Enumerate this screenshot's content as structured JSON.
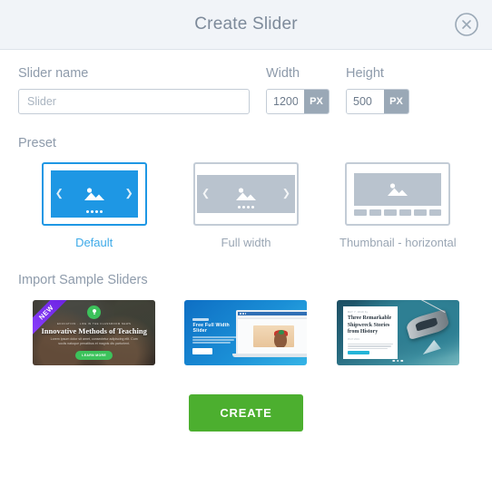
{
  "header": {
    "title": "Create Slider",
    "close_icon": "close-circle-icon"
  },
  "form": {
    "name_label": "Slider name",
    "name_value": "",
    "name_placeholder": "Slider",
    "width_label": "Width",
    "width_value": "1200",
    "width_unit": "PX",
    "height_label": "Height",
    "height_value": "500",
    "height_unit": "PX"
  },
  "preset": {
    "section_label": "Preset",
    "selected": "Default",
    "items": [
      {
        "label": "Default",
        "layout": "boxed",
        "selected": true
      },
      {
        "label": "Full width",
        "layout": "fullwidth",
        "selected": false
      },
      {
        "label": "Thumbnail - horizontal",
        "layout": "thumbnail",
        "selected": false
      }
    ]
  },
  "samples": {
    "section_label": "Import Sample Sliders",
    "items": [
      {
        "badge": "NEW",
        "kicker": "EDUCATION  ·  LIFE IN THE CLASSROOM NEWS",
        "title": "Innovative Methods of Teaching",
        "subtitle": "Lorem ipsum dolor sit amet, consectetur adipiscing elit. Cum sociis natoque penatibus et magnis dis parturient.",
        "button": "LEARN MORE"
      },
      {
        "kicker": "",
        "title": "Free Full Width Slider",
        "subtitle": "Free slider for your website, easy to install, works great on WordPress, Magento, Joomla, Drupal and any simple html site.",
        "button": ""
      },
      {
        "kicker": "MAY 7, 2019 by",
        "author": "CAPTAIN CLARK",
        "title": "Three Remarkable Shipwreck Stories from History",
        "date": "05.07.2019",
        "subtitle": "Lorem ipsum dolor sit amet, adipiscing elit sed do eiusmod tempor incididunt ut labore et dolore magna aliqua.",
        "button": "READ MORE"
      }
    ]
  },
  "footer": {
    "create_label": "CREATE"
  },
  "colors": {
    "accent_blue": "#1e97e4",
    "create_green": "#4caf2f",
    "label_gray": "#8e9bab",
    "border_gray": "#c3ccd6",
    "header_bg": "#f1f4f8",
    "panel_gray": "#b9c3ce"
  }
}
